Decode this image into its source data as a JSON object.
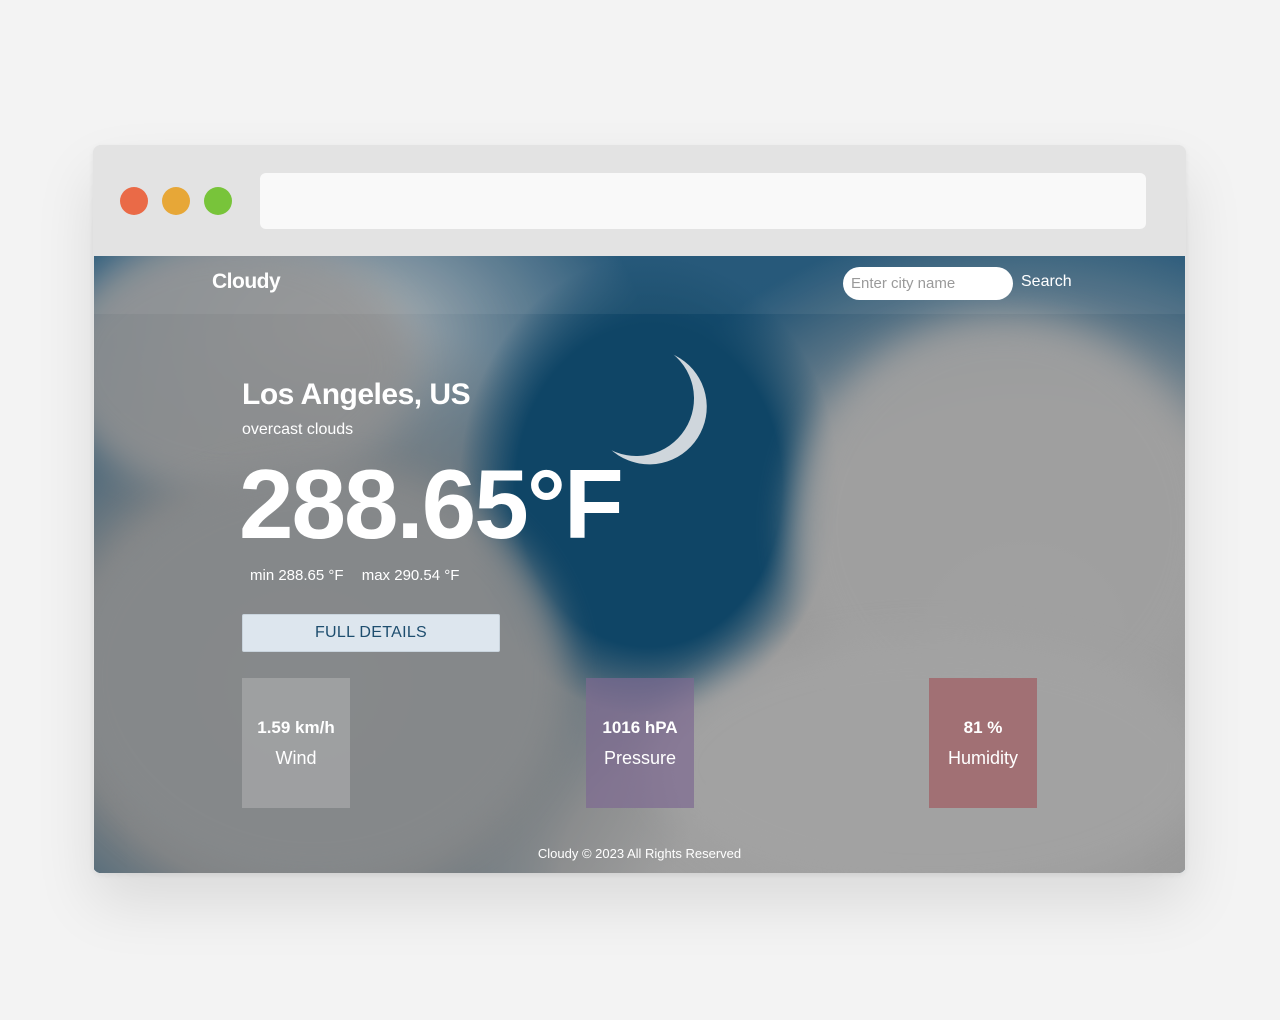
{
  "browser": {
    "address_value": ""
  },
  "navbar": {
    "logo": "Cloudy",
    "search_placeholder": "Enter city name",
    "search_label": "Search"
  },
  "weather": {
    "city": "Los Angeles, US",
    "description": "overcast clouds",
    "temperature": "288.65°F",
    "min": "min 288.65 °F",
    "max": "max 290.54 °F",
    "details_button": "FULL DETAILS"
  },
  "cards": {
    "wind": {
      "value": "1.59 km/h",
      "label": "Wind"
    },
    "pressure": {
      "value": "1016 hPA",
      "label": "Pressure"
    },
    "humidity": {
      "value": "81 %",
      "label": "Humidity"
    }
  },
  "footer": {
    "logo": "Cloudy",
    "text": "© 2023 All Rights Reserved"
  },
  "colors": {
    "close": "#ea6a47",
    "minimize": "#e7a737",
    "maximize": "#78c43a",
    "wind_card": "#b2b2b4",
    "pressure_card": "#7d6991",
    "humidity_card": "#a05f64"
  }
}
